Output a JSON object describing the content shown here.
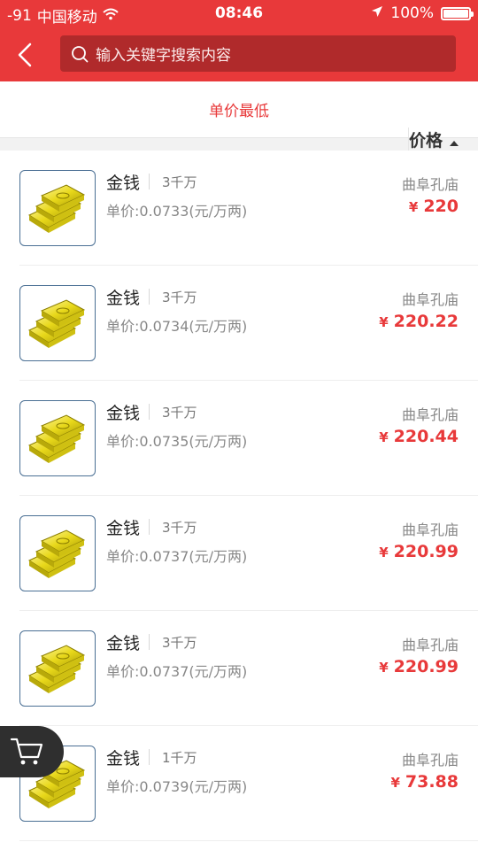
{
  "status_bar": {
    "signal": "-91",
    "carrier": "中国移动",
    "time": "08:46",
    "battery": "100%"
  },
  "search": {
    "placeholder": "输入关键字搜索内容"
  },
  "sort": {
    "tab_lowest_unit_price": "单价最低",
    "tab_price": "价格"
  },
  "colors": {
    "brand_red": "#e8393a",
    "search_bg": "#b02a2b"
  },
  "items": [
    {
      "name": "金钱",
      "qty": "3千万",
      "unit_price": "单价:0.0733(元/万两)",
      "server": "曲阜孔庙",
      "price": "220"
    },
    {
      "name": "金钱",
      "qty": "3千万",
      "unit_price": "单价:0.0734(元/万两)",
      "server": "曲阜孔庙",
      "price": "220.22"
    },
    {
      "name": "金钱",
      "qty": "3千万",
      "unit_price": "单价:0.0735(元/万两)",
      "server": "曲阜孔庙",
      "price": "220.44"
    },
    {
      "name": "金钱",
      "qty": "3千万",
      "unit_price": "单价:0.0737(元/万两)",
      "server": "曲阜孔庙",
      "price": "220.99"
    },
    {
      "name": "金钱",
      "qty": "3千万",
      "unit_price": "单价:0.0737(元/万两)",
      "server": "曲阜孔庙",
      "price": "220.99"
    },
    {
      "name": "金钱",
      "qty": "1千万",
      "unit_price": "单价:0.0739(元/万两)",
      "server": "曲阜孔庙",
      "price": "73.88"
    }
  ],
  "currency_symbol": "¥"
}
